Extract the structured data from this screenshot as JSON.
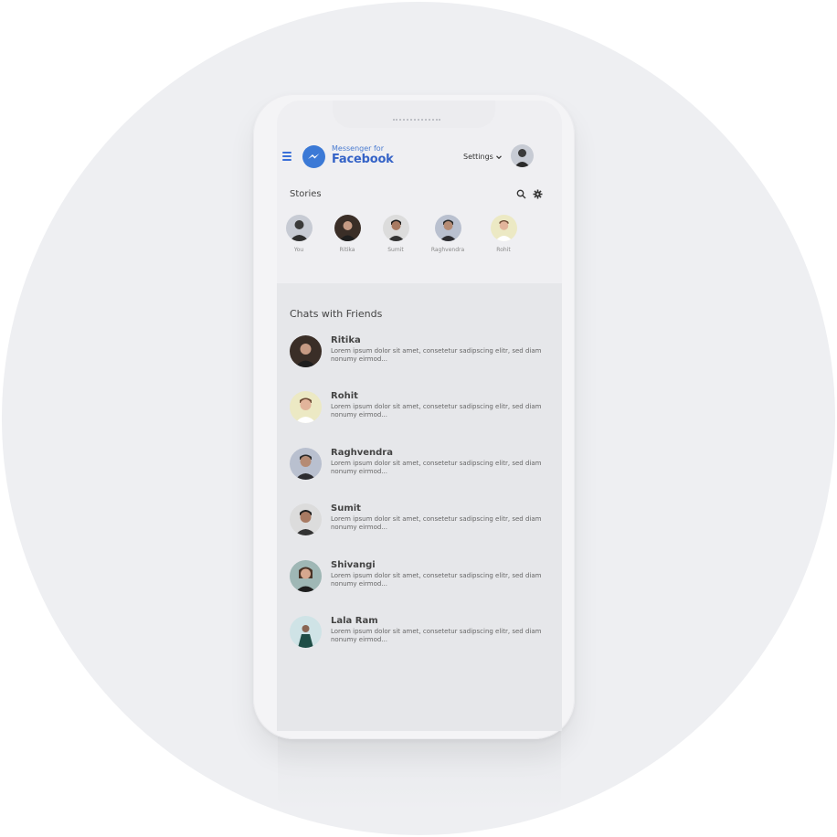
{
  "header": {
    "brand_small": "Messenger for",
    "brand_big": "Facebook",
    "settings_label": "Settings"
  },
  "stories": {
    "label": "Stories",
    "items": [
      {
        "name": "You",
        "bg": "#c7cbd4",
        "skin": "#3a3a3a"
      },
      {
        "name": "Ritika",
        "bg": "#3a2e27",
        "skin": "#c79b84"
      },
      {
        "name": "Sumit",
        "bg": "#dcdcdc",
        "skin": "#a87a62"
      },
      {
        "name": "Raghvendra",
        "bg": "#b9c0cf",
        "skin": "#b58b74"
      },
      {
        "name": "Rohit",
        "bg": "#ece9c4",
        "skin": "#e2b49b"
      }
    ]
  },
  "chats": {
    "title": "Chats with Friends",
    "items": [
      {
        "name": "Ritika",
        "message": "Lorem ipsum dolor sit amet, consetetur sadipscing elitr, sed diam nonumy eirmod...",
        "bg": "#3a2e27",
        "skin": "#c79b84"
      },
      {
        "name": "Rohit",
        "message": "Lorem ipsum dolor sit amet, consetetur sadipscing elitr, sed diam nonumy eirmod...",
        "bg": "#ece9c4",
        "skin": "#e2b49b"
      },
      {
        "name": "Raghvendra",
        "message": "Lorem ipsum dolor sit amet, consetetur sadipscing elitr, sed diam nonumy eirmod...",
        "bg": "#b9c0cf",
        "skin": "#b58b74"
      },
      {
        "name": "Sumit",
        "message": "Lorem ipsum dolor sit amet, consetetur sadipscing elitr, sed diam nonumy eirmod...",
        "bg": "#dcdcdc",
        "skin": "#a87a62"
      },
      {
        "name": "Shivangi",
        "message": "Lorem ipsum dolor sit amet, consetetur sadipscing elitr, sed diam nonumy eirmod...",
        "bg": "#9fb7b5",
        "skin": "#d6a88f"
      },
      {
        "name": "Lala Ram",
        "message": "Lorem ipsum dolor sit amet, consetetur sadipscing elitr, sed diam nonumy eirmod...",
        "bg": "#cfe3e6",
        "skin": "#8a6552"
      }
    ]
  },
  "colors": {
    "accent": "#3b79d6",
    "background": "#eeeff2"
  }
}
